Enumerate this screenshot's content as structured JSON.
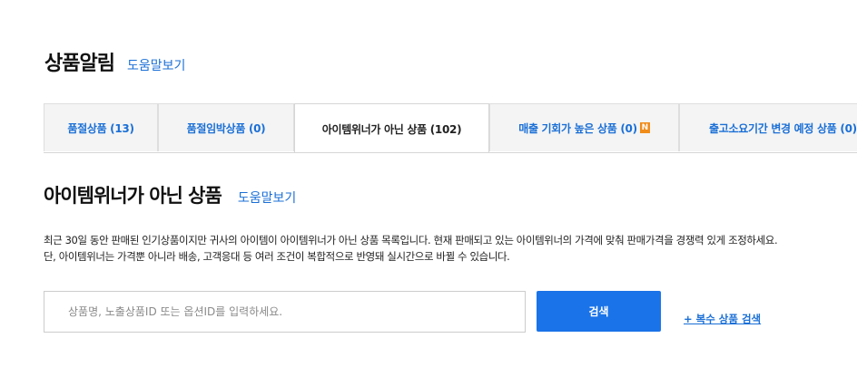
{
  "header": {
    "title": "상품알림",
    "help_label": "도움말보기"
  },
  "tabs": [
    {
      "label": "품절상품 (13)",
      "active": false
    },
    {
      "label": "품절임박상품 (0)",
      "active": false
    },
    {
      "label": "아이템위너가 아닌 상품 (102)",
      "active": true
    },
    {
      "label": "매출 기회가 높은 상품 (0)",
      "active": false,
      "badge": "N"
    },
    {
      "label": "출고소요기간 변경 예정 상품 (0)",
      "active": false
    }
  ],
  "section": {
    "title": "아이템위너가 아닌 상품",
    "help_label": "도움말보기",
    "description_lines": [
      "최근 30일 동안 판매된 인기상품이지만 귀사의 아이템이 아이템위너가 아닌 상품 목록입니다. 현재 판매되고 있는 아이템위너의 가격에 맞춰 판매가격을 경쟁력 있게 조정하세요.",
      "단, 아이템위너는 가격뿐 아니라 배송, 고객응대 등 여러 조건이 복합적으로 반영돼 실시간으로 바뀔 수 있습니다."
    ]
  },
  "search": {
    "placeholder": "상품명, 노출상품ID 또는 옵션ID를 입력하세요.",
    "value": "",
    "button_label": "검색",
    "multi_search_label": "+ 복수 상품 검색"
  },
  "colors": {
    "accent": "#1a73e8",
    "link": "#1a6fd6",
    "badge": "#f08c1a"
  }
}
